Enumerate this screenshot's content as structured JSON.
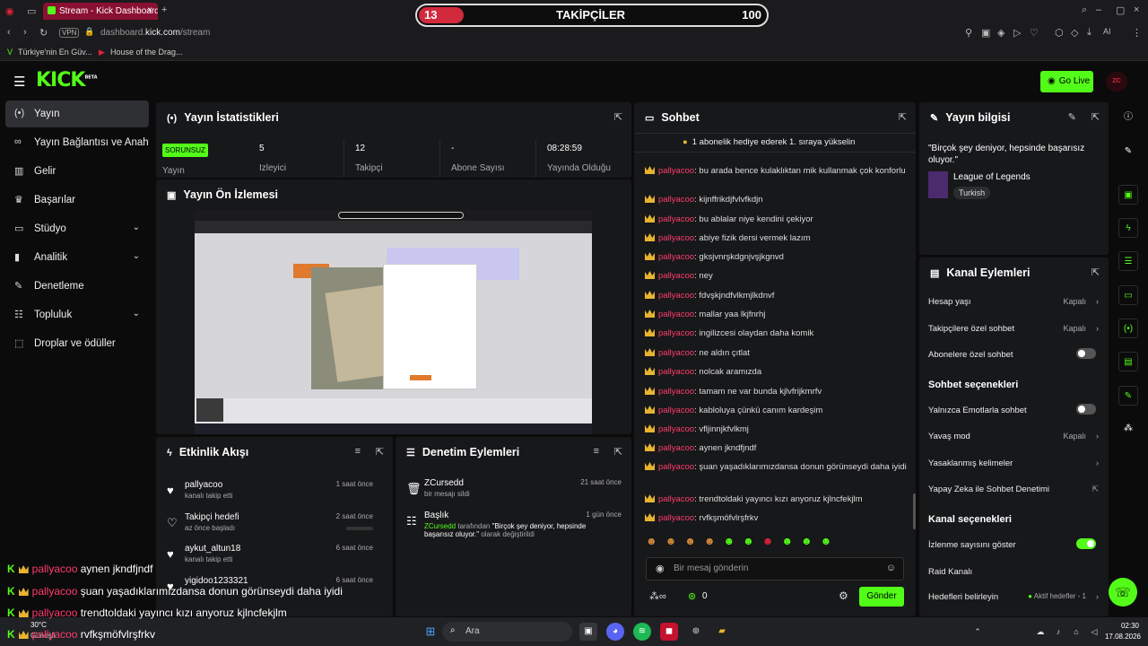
{
  "browser": {
    "tab_title": "Stream - Kick Dashboard",
    "url_host": "dashboard.",
    "url_domain": "kick.com",
    "url_path": "/stream",
    "vpn": "VPN",
    "bookmarks": [
      "Türkiye'nin En Güv...",
      "House of the Drag..."
    ]
  },
  "follow_overlay": {
    "count": "13",
    "title": "TAKİPÇİLER",
    "goal": "100",
    "progress": 0.13
  },
  "header": {
    "logo": "KICK",
    "beta": "BETA",
    "go_live": "Go Live"
  },
  "sidebar": {
    "items": [
      {
        "label": "Yayın",
        "icon": "broadcast-icon"
      },
      {
        "label": "Yayın Bağlantısı ve Anahtar",
        "icon": "link-icon"
      },
      {
        "label": "Gelir",
        "icon": "revenue-icon"
      },
      {
        "label": "Başarılar",
        "icon": "trophy-icon"
      },
      {
        "label": "Stüdyo",
        "icon": "studio-icon"
      },
      {
        "label": "Analitik",
        "icon": "analytics-icon"
      },
      {
        "label": "Denetleme",
        "icon": "wrench-icon"
      },
      {
        "label": "Topluluk",
        "icon": "community-icon"
      },
      {
        "label": "Droplar ve ödüller",
        "icon": "drops-icon"
      }
    ]
  },
  "stats": {
    "title": "Yayın İstatistikleri",
    "status": "SORUNSUZ",
    "status_label": "Yayın",
    "items": [
      {
        "value": "5",
        "label": "İzleyici"
      },
      {
        "value": "12",
        "label": "Takipçi"
      },
      {
        "value": "-",
        "label": "Abone Sayısı"
      },
      {
        "value": "08:28:59",
        "label": "Yayında Olduğu"
      }
    ]
  },
  "preview": {
    "title": "Yayın Ön İzlemesi"
  },
  "activity": {
    "title": "Etkinlik Akışı",
    "events": [
      {
        "name": "pallyacoo",
        "sub": "kanalı takip etti",
        "time": "1 saat önce"
      },
      {
        "name": "Takipçi hedefi",
        "sub": "az önce başladı",
        "time": "2 saat önce"
      },
      {
        "name": "aykut_altun18",
        "sub": "kanalı takip etti",
        "time": "6 saat önce"
      },
      {
        "name": "yigidoo1233321",
        "sub": "",
        "time": "6 saat önce"
      }
    ]
  },
  "moderation": {
    "title": "Denetim Eylemleri",
    "actions": [
      {
        "name": "ZCursedd",
        "sub": "bir mesajı sildi",
        "time": "21 saat önce"
      },
      {
        "name": "Başlık",
        "user": "ZCursedd",
        "sub1": " tarafından ",
        "quote": "\"Birçok şey deniyor, hepsinde başarısız oluyor.\"",
        "sub2": " olarak değiştirildi",
        "time": "1 gün önce"
      }
    ]
  },
  "chat": {
    "title": "Sohbet",
    "pinned": "1 abonelik hediye ederek 1. sıraya yükselin",
    "messages": [
      {
        "user": "pallyacoo",
        "text": ": bu arada bence kulaklıktan mik kullanmak çok konforlu"
      },
      {
        "user": "pallyacoo",
        "text": ": kijnffrikdjfvlvfkdjn"
      },
      {
        "user": "pallyacoo",
        "text": ": bu ablalar niye kendini çekiyor"
      },
      {
        "user": "pallyacoo",
        "text": ": abiye fizik dersi vermek lazım"
      },
      {
        "user": "pallyacoo",
        "text": ": gksjvnrşkdgnjvşjkgnvd"
      },
      {
        "user": "pallyacoo",
        "text": ": ney"
      },
      {
        "user": "pallyacoo",
        "text": ": fdvşkjndfvlkmjlkdnvf"
      },
      {
        "user": "pallyacoo",
        "text": ": mallar yaa lkjfnrhj"
      },
      {
        "user": "pallyacoo",
        "text": ": ingilizcesi olaydan daha komik"
      },
      {
        "user": "pallyacoo",
        "text": ": ne aldın çıtlat"
      },
      {
        "user": "pallyacoo",
        "text": ": nolcak aramızda"
      },
      {
        "user": "pallyacoo",
        "text": ": tamam ne var bunda kjlvfrijkmrfv"
      },
      {
        "user": "pallyacoo",
        "text": ": kabloluya çünkü canım kardeşim"
      },
      {
        "user": "pallyacoo",
        "text": ": vfljinnjkfvlkmj"
      },
      {
        "user": "pallyacoo",
        "text": ": aynen jkndfjndf"
      },
      {
        "user": "pallyacoo",
        "text": ": şuan yaşadıklarımızdansa donun görünseydi daha iyidi"
      },
      {
        "user": "pallyacoo",
        "text": ": trendtoldaki yayıncı kızı anyoruz kjlncfekjlm"
      },
      {
        "user": "pallyacoo",
        "text": ": rvfkşmöfvlrşfrkv"
      }
    ],
    "input_placeholder": "Bir mesaj gönderin",
    "points": "0",
    "send": "Gönder"
  },
  "stream_info": {
    "title": "Yayın bilgisi",
    "stream_title": "\"Birçok şey deniyor, hepsinde başarısız oluyor.\"",
    "category": "League of Legends",
    "language": "Turkish"
  },
  "channel_actions": {
    "title": "Kanal Eylemleri",
    "rows1": [
      {
        "label": "Hesap yaşı",
        "value": "Kapalı"
      },
      {
        "label": "Takipçilere özel sohbet",
        "value": "Kapalı"
      },
      {
        "label": "Abonelere özel sohbet",
        "toggle": false
      }
    ],
    "chat_options": "Sohbet seçenekleri",
    "rows2": [
      {
        "label": "Yalnızca Emotlarla sohbet",
        "toggle": false
      },
      {
        "label": "Yavaş mod",
        "value": "Kapalı"
      },
      {
        "label": "Yasaklanmış kelimeler"
      },
      {
        "label": "Yapay Zeka ile Sohbet Denetimi"
      }
    ],
    "channel_options": "Kanal seçenekleri",
    "rows3": [
      {
        "label": "İzlenme sayısını göster",
        "toggle": true
      },
      {
        "label": "Raid Kanalı"
      },
      {
        "label": "Hedefleri belirleyin",
        "value": "Aktif hedefler - 1"
      }
    ]
  },
  "overlay_chat": [
    {
      "user": "pallyacoo",
      "text": " aynen jkndfjndf"
    },
    {
      "user": "pallyacoo",
      "text": " şuan yaşadıklarımızdansa donun görünseydi daha iyidi"
    },
    {
      "user": "pallyacoo",
      "text": " trendtoldaki yayıncı kızı anyoruz kjlncfekjlm"
    },
    {
      "user": "pallyacoo",
      "text": " rvfkşmöfvlrşfrkv"
    }
  ],
  "taskbar": {
    "weather_temp": "30°C",
    "weather_desc": "Güneşli",
    "search": "Ara",
    "time": "02:30",
    "date": "17.08.2026"
  },
  "colors": {
    "accent": "#53fc18",
    "username": "#ff3b6e",
    "panel": "#17181a"
  }
}
